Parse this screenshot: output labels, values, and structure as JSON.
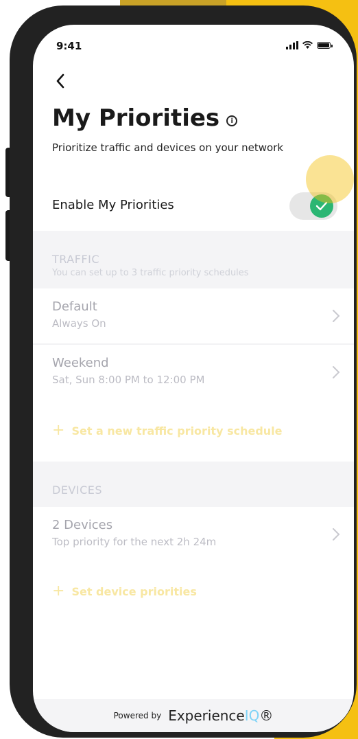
{
  "status_bar": {
    "time": "9:41",
    "icons": [
      "signal-icon",
      "wifi-icon",
      "battery-icon"
    ]
  },
  "header": {
    "back_icon": "chevron-left-icon",
    "title": "My Priorities",
    "info_icon": "info-icon",
    "subtitle": "Prioritize traffic and devices on your network"
  },
  "enable": {
    "label": "Enable My Priorities",
    "enabled": true,
    "toggle_color": "#2bb673"
  },
  "traffic": {
    "title": "TRAFFIC",
    "subtitle": "You can set up to 3 traffic priority schedules",
    "items": [
      {
        "title": "Default",
        "subtitle": "Always On"
      },
      {
        "title": "Weekend",
        "subtitle": "Sat, Sun 8:00 PM to 12:00 PM"
      }
    ],
    "add_label": "Set a new traffic priority schedule"
  },
  "devices": {
    "title": "DEVICES",
    "items": [
      {
        "title": "2 Devices",
        "subtitle": "Top priority for the next 2h 24m"
      }
    ],
    "add_label": "Set device priorities"
  },
  "footer": {
    "powered_by": "Powered by",
    "brand_main": "Experience",
    "brand_iq": "IQ",
    "brand_mark": "®"
  },
  "colors": {
    "accent_yellow": "#f5c012",
    "add_link": "#f8e7a2",
    "brand_iq": "#7fd3f7"
  }
}
